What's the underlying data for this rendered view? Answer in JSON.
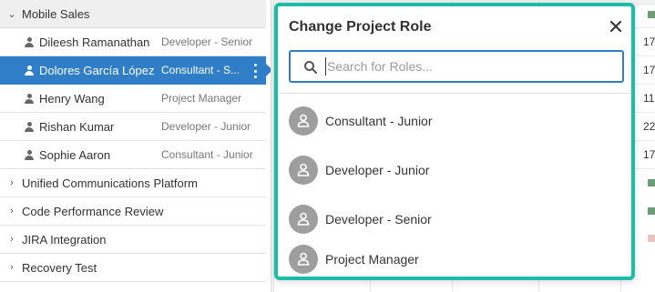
{
  "tree": {
    "group_open": {
      "name": "Mobile Sales"
    },
    "people": [
      {
        "name": "Dileesh Ramanathan",
        "role": "Developer - Senior"
      },
      {
        "name": "Dolores García López",
        "role": "Consultant - S..."
      },
      {
        "name": "Henry Wang",
        "role": "Project Manager"
      },
      {
        "name": "Rishan Kumar",
        "role": "Developer - Junior"
      },
      {
        "name": "Sophie Aaron",
        "role": "Consultant - Junior"
      }
    ],
    "collapsed_groups": [
      {
        "name": "Unified Communications Platform"
      },
      {
        "name": "Code Performance Review"
      },
      {
        "name": "JIRA Integration"
      },
      {
        "name": "Recovery Test"
      }
    ]
  },
  "gantt": {
    "values": [
      "17",
      "17",
      "11",
      "22",
      "17"
    ]
  },
  "popup": {
    "title": "Change Project Role",
    "search_placeholder": "Search for Roles...",
    "search_value": "",
    "roles": [
      {
        "label": "Consultant - Junior"
      },
      {
        "label": "Developer - Junior"
      },
      {
        "label": "Developer - Senior"
      },
      {
        "label": "Project Manager"
      }
    ]
  },
  "colors": {
    "selection": "#2f7ec7",
    "popup_border": "#1bbda8",
    "avatar": "#9e9e9e",
    "gantt_bar": "#6a9c76"
  },
  "icons": {
    "close": "close-icon",
    "search": "search-icon",
    "person": "person-icon",
    "more": "more-vertical-icon",
    "caret": "chevron-right-icon"
  }
}
